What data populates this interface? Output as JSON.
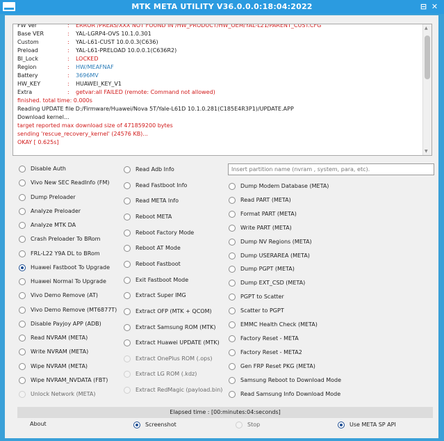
{
  "window": {
    "title": "MTK META UTILITY V36.0.0.0:18:04:2022",
    "minimize_glyph": "⊟",
    "close_glyph": "✕"
  },
  "log": {
    "lines": [
      {
        "key": "FW Ver",
        "colon": ":",
        "value": "ERROR /PREAS/XXX NOT FOUND IN /HW_PRODUCT/HW_OEM/YAL-L21/PARENT_CUST.CFG",
        "color": "#d11a1a"
      },
      {
        "key": "Base VER",
        "colon": ":",
        "value": "YAL-LGRP4-OVS 10.1.0.301",
        "color": "#1e1e1e"
      },
      {
        "key": "Custom",
        "colon": ":",
        "value": "YAL-L61-CUST 10.0.0.3(C636)",
        "color": "#1e1e1e"
      },
      {
        "key": "Preload",
        "colon": ":",
        "value": "YAL-L61-PRELOAD 10.0.0.1(C636R2)",
        "color": "#1e1e1e"
      },
      {
        "key": "Bl_Lock",
        "colon": ":",
        "value": "LOCKED",
        "color": "#d11a1a"
      },
      {
        "key": "Region",
        "colon": ":",
        "value": "HW/MEAFNAF",
        "color": "#2a7bb8"
      },
      {
        "key": "Battery",
        "colon": ":",
        "value": "3696MV",
        "color": "#2a7bb8"
      },
      {
        "key": "HW_KEY",
        "colon": ":",
        "value": "HUAWEI_KEY_V1",
        "color": "#1e1e1e"
      },
      {
        "key": "Extra",
        "colon": ":",
        "value": "getvar:all FAILED (remote: Command not allowed)",
        "color": "#d11a1a"
      },
      {
        "text": "finished. total time: 0.000s",
        "color": "#d11a1a"
      },
      {
        "text": "Reading UPDATE file D:/Firmware/Huawei/Nova 5T/Yale-L61D 10.1.0.281(C185E4R3P1)/UPDATE.APP",
        "color": "#1e1e1e"
      },
      {
        "text": "Download kernel...",
        "color": "#1e1e1e"
      },
      {
        "text": "target reported max download size of 471859200 bytes",
        "color": "#d11a1a"
      },
      {
        "text": "sending 'rescue_recovery_kernel' (24576 KB)...",
        "color": "#d11a1a"
      },
      {
        "text": "OKAY [  0.625s]",
        "color": "#d11a1a"
      }
    ]
  },
  "search": {
    "placeholder": "Insert partition name (nvram , system, para, etc)."
  },
  "col1": [
    {
      "label": "Disable Auth",
      "state": "off"
    },
    {
      "label": "Vivo New SEC ReadInfo (FM)",
      "state": "off"
    },
    {
      "label": "Dump Preloader",
      "state": "off"
    },
    {
      "label": "Analyze Preloader",
      "state": "off"
    },
    {
      "label": "Analyze MTK DA",
      "state": "off"
    },
    {
      "label": "Crash Preloader To BRom",
      "state": "off"
    },
    {
      "label": "FRL-L22 Y9A DL to BRom",
      "state": "off"
    },
    {
      "label": "Huawei Fastboot To Upgrade",
      "state": "on"
    },
    {
      "label": "Huawei Normal To Upgrade",
      "state": "off"
    },
    {
      "label": "Vivo Demo Remove (AT)",
      "state": "off"
    },
    {
      "label": "Vivo Demo Remove (MT6877T)",
      "state": "off"
    },
    {
      "label": "Disable Payjoy APP (ADB)",
      "state": "off"
    },
    {
      "label": "Read NVRAM (META)",
      "state": "off"
    },
    {
      "label": "Write NVRAM (META)",
      "state": "off"
    },
    {
      "label": "Wipe NVRAM (META)",
      "state": "off"
    },
    {
      "label": "Wipe NVRAM_NVDATA (FBT)",
      "state": "off"
    },
    {
      "label": "Unlock Network (META)",
      "state": "dis"
    }
  ],
  "col2": [
    {
      "label": "Read Adb Info",
      "state": "off"
    },
    {
      "label": "Read Fastboot Info",
      "state": "off"
    },
    {
      "label": "Read META Info",
      "state": "off"
    },
    {
      "label": "Reboot META",
      "state": "off"
    },
    {
      "label": "Reboot Factory Mode",
      "state": "off"
    },
    {
      "label": "Reboot AT Mode",
      "state": "off"
    },
    {
      "label": "Reboot Fastboot",
      "state": "off"
    },
    {
      "label": "Exit Fastboot Mode",
      "state": "off"
    },
    {
      "label": "Extract Super IMG",
      "state": "off"
    },
    {
      "label": "Extract OFP (MTK + QCOM)",
      "state": "off"
    },
    {
      "label": "Extract Samsung ROM (MTK)",
      "state": "off"
    },
    {
      "label": "Extract Huawei UPDATE (MTK)",
      "state": "off"
    },
    {
      "label": "Extract OnePlus ROM (.ops)",
      "state": "dis"
    },
    {
      "label": "Extract LG ROM (.kdz)",
      "state": "dis"
    },
    {
      "label": "Extract RedMagic (payload.bin)",
      "state": "dis"
    }
  ],
  "col3": [
    {
      "label": "Dump Modem Database (META)",
      "state": "off"
    },
    {
      "label": "Read PART (META)",
      "state": "off"
    },
    {
      "label": "Format PART (META)",
      "state": "off"
    },
    {
      "label": "Write PART (META)",
      "state": "off"
    },
    {
      "label": "Dump NV Regions (META)",
      "state": "off"
    },
    {
      "label": "Dump USERAREA (META)",
      "state": "off"
    },
    {
      "label": "Dump PGPT (META)",
      "state": "off"
    },
    {
      "label": "Dump  EXT_CSD (META)",
      "state": "off"
    },
    {
      "label": "PGPT to Scatter",
      "state": "off"
    },
    {
      "label": "Scatter to PGPT",
      "state": "off"
    },
    {
      "label": "EMMC Health Check (META)",
      "state": "off"
    },
    {
      "label": "Factory Reset - META",
      "state": "off"
    },
    {
      "label": "Factory Reset - META2",
      "state": "off"
    },
    {
      "label": "Gen FRP Reset PKG (META)",
      "state": "off"
    },
    {
      "label": "Samsung Reboot to Download Mode",
      "state": "off"
    },
    {
      "label": "Read Samsung Info Download Mode",
      "state": "off"
    }
  ],
  "status": {
    "elapsed": "Elapsed time : [00:minutes:04:seconds]"
  },
  "bottom": {
    "about": "About",
    "screenshot": {
      "label": "Screenshot",
      "state": "on"
    },
    "stop": {
      "label": "Stop",
      "state": "dis"
    },
    "meta_sp_api": {
      "label": "Use META SP API",
      "state": "on"
    }
  },
  "colors": {
    "titlebar": "#2b9be0",
    "selected": "#1f4f93",
    "error": "#d11a1a",
    "info": "#2a7bb8"
  },
  "icons": {
    "app": "app-logo-icon",
    "minimize": "minimize-icon",
    "close": "close-icon"
  }
}
